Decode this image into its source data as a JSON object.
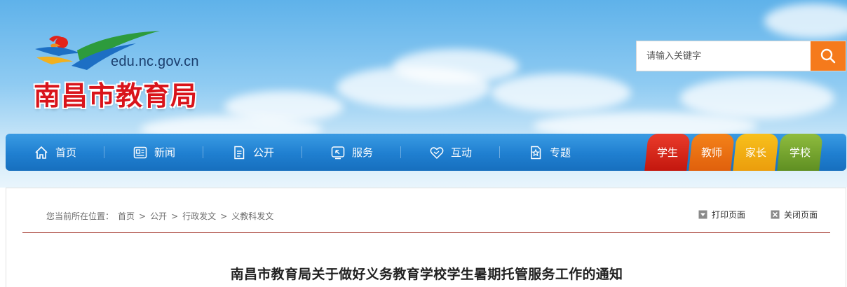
{
  "site": {
    "domain": "edu.nc.gov.cn",
    "name": "南昌市教育局"
  },
  "search": {
    "placeholder": "请输入关键字",
    "button_icon": "search-icon"
  },
  "nav": {
    "items": [
      {
        "label": "首页",
        "icon": "home-icon"
      },
      {
        "label": "新闻",
        "icon": "newspaper-icon"
      },
      {
        "label": "公开",
        "icon": "document-icon"
      },
      {
        "label": "服务",
        "icon": "service-icon"
      },
      {
        "label": "互动",
        "icon": "heart-icon"
      },
      {
        "label": "专题",
        "icon": "star-icon"
      }
    ],
    "roles": [
      {
        "label": "学生",
        "color": "#d2231a"
      },
      {
        "label": "教师",
        "color": "#ea6d12"
      },
      {
        "label": "家长",
        "color": "#f2ae14"
      },
      {
        "label": "学校",
        "color": "#76a52e"
      }
    ]
  },
  "breadcrumb": {
    "prefix": "您当前所在位置：",
    "items": [
      "首页",
      "公开",
      "行政发文",
      "义教科发文"
    ],
    "separator": ">"
  },
  "tools": {
    "print": "打印页面",
    "close": "关闭页面"
  },
  "article": {
    "title": "南昌市教育局关于做好义务教育学校学生暑期托管服务工作的通知"
  },
  "colors": {
    "accent": "#1f7fd0",
    "search_button": "#f57a1c",
    "title_red": "#d9141b",
    "divider": "#9e2d22"
  }
}
